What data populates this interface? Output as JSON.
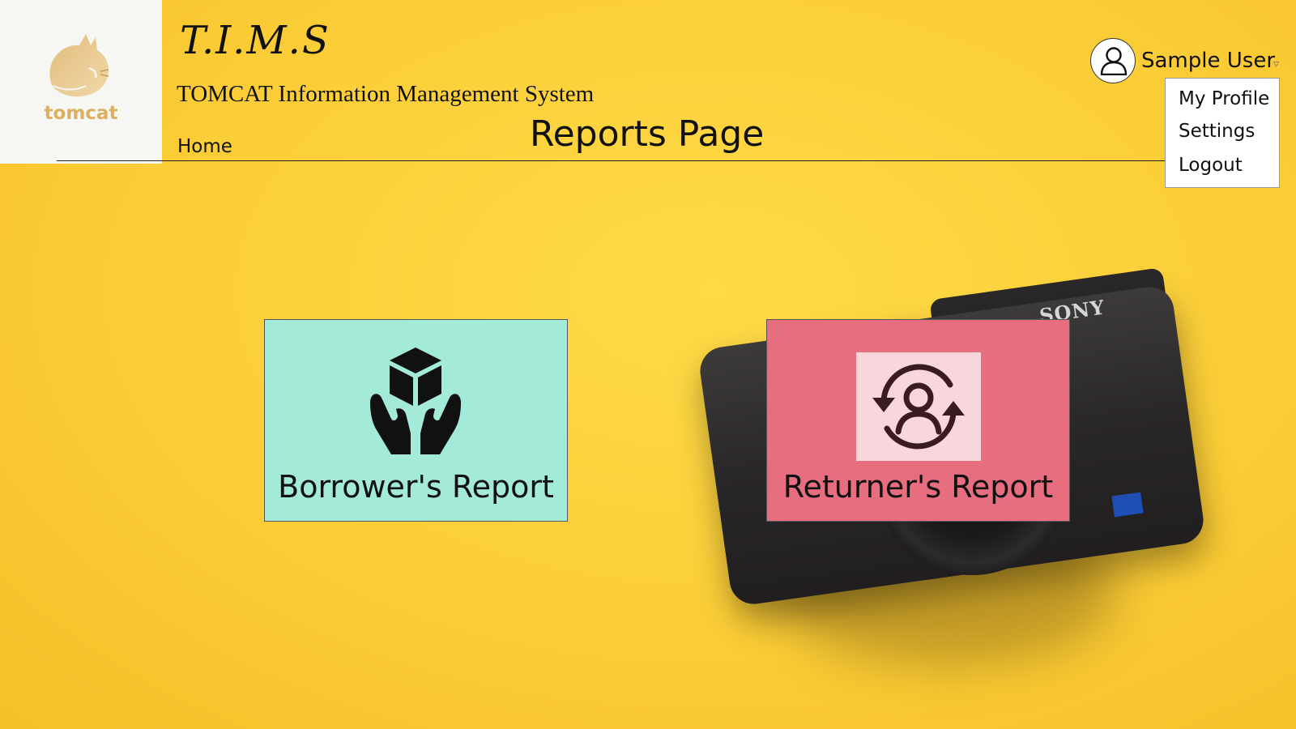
{
  "header": {
    "logo_text": "tomcat",
    "app_title": "T.I.M.S",
    "app_subtitle": "TOMCAT Information Management System",
    "nav_home": "Home",
    "page_title": "Reports Page"
  },
  "user_menu": {
    "user_name": "Sample User",
    "caret": "▿",
    "items": [
      {
        "label": "My Profile",
        "icon": ""
      },
      {
        "label": "Settings",
        "icon": ""
      },
      {
        "label": "Logout",
        "icon": ""
      }
    ]
  },
  "reports": [
    {
      "label": "Borrower's Report",
      "icon": "hands-holding-box-icon",
      "color": "#a3ead8"
    },
    {
      "label": "Returner's Report",
      "icon": "user-sync-icon",
      "color": "#e66e7f"
    }
  ],
  "background": {
    "camera_brand": "SONY"
  },
  "colors": {
    "background": "#fcd03a",
    "logo_gold": "#dcaf63"
  }
}
